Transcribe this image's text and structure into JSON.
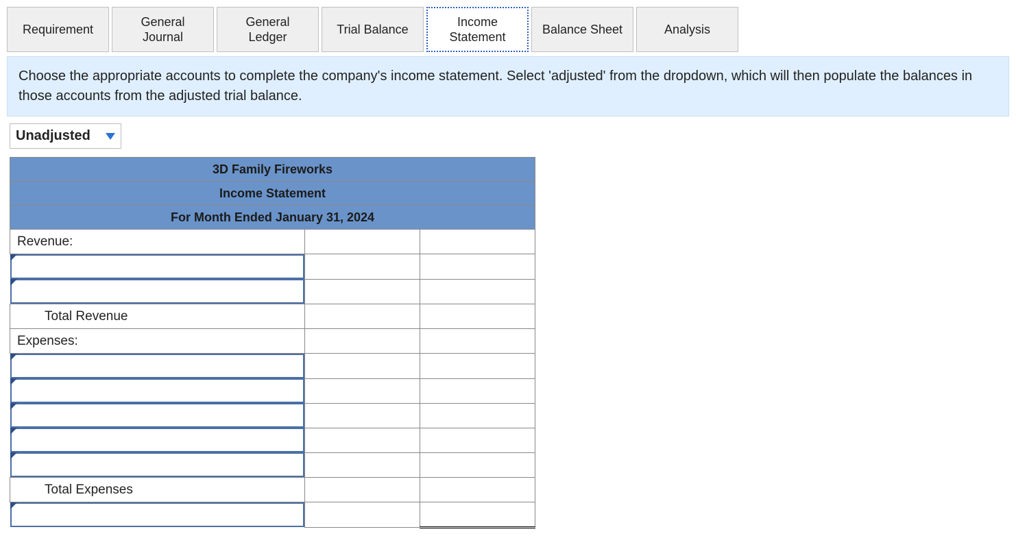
{
  "tabs": {
    "requirement": "Requirement",
    "general_journal": "General\nJournal",
    "general_ledger": "General\nLedger",
    "trial_balance": "Trial Balance",
    "income_statement": "Income\nStatement",
    "balance_sheet": "Balance Sheet",
    "analysis": "Analysis"
  },
  "active_tab": "income_statement",
  "infobar": "Choose the appropriate accounts to complete the company's income statement. Select 'adjusted' from the dropdown, which will then populate the balances in those accounts from the adjusted trial balance.",
  "dropdown": {
    "label": "Unadjusted"
  },
  "statement": {
    "company": "3D Family Fireworks",
    "title": "Income Statement",
    "period": "For Month Ended January 31, 2024",
    "rows": {
      "revenue_header": "Revenue:",
      "revenue_lines": [
        "",
        ""
      ],
      "total_revenue": "Total Revenue",
      "expenses_header": "Expenses:",
      "expense_lines": [
        "",
        "",
        "",
        "",
        ""
      ],
      "total_expenses": "Total Expenses",
      "net_line": ""
    }
  }
}
